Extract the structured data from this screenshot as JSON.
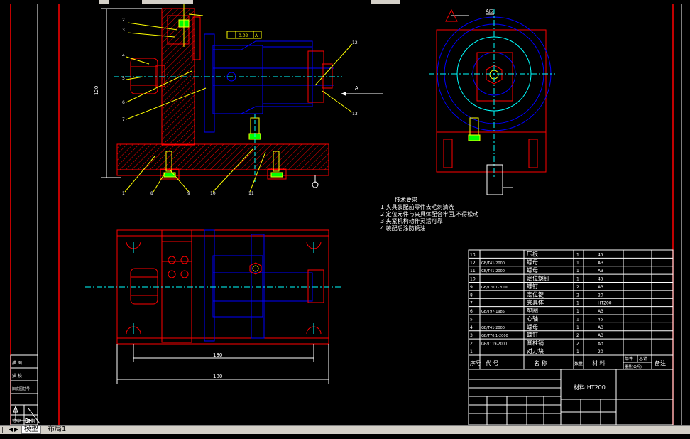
{
  "drawing": {
    "dim_side_height": "120",
    "dim_plan_inner": "130",
    "dim_plan_outer": "180",
    "datum_label": "A",
    "tolerance_value": "0.02",
    "tolerance_datum": "A",
    "top_view_label": "A向",
    "arrow_label": "A",
    "leader_numbers": [
      "1",
      "2",
      "3",
      "4",
      "5",
      "6",
      "7",
      "8",
      "9",
      "10",
      "11",
      "12",
      "13"
    ]
  },
  "technical_requirements": {
    "title": "技术要求",
    "items": [
      "1.夹具装配前零件去毛刺清洗",
      "2.定位元件与夹具体配合牢固,不得松动",
      "3.夹紧机构动作灵活可靠",
      "4.装配后涂防锈油"
    ]
  },
  "parts_list": {
    "rows": [
      {
        "no": "13",
        "code": "",
        "name": "压板",
        "qty": "1",
        "material": "45"
      },
      {
        "no": "12",
        "code": "GB/T41-2000",
        "name": "螺母",
        "qty": "1",
        "material": "A3"
      },
      {
        "no": "11",
        "code": "GB/T41-2000",
        "name": "螺母",
        "qty": "1",
        "material": "A3"
      },
      {
        "no": "10",
        "code": "",
        "name": "定位螺钉",
        "qty": "1",
        "material": "45"
      },
      {
        "no": "9",
        "code": "GB/T70.1-2000",
        "name": "螺钉",
        "qty": "2",
        "material": "A3"
      },
      {
        "no": "8",
        "code": "",
        "name": "定位键",
        "qty": "2",
        "material": "20"
      },
      {
        "no": "7",
        "code": "",
        "name": "夹具体",
        "qty": "1",
        "material": "HT200"
      },
      {
        "no": "6",
        "code": "GB/T97-1985",
        "name": "垫圈",
        "qty": "1",
        "material": "A3"
      },
      {
        "no": "5",
        "code": "",
        "name": "心轴",
        "qty": "1",
        "material": "45"
      },
      {
        "no": "4",
        "code": "GB/T41-2000",
        "name": "螺母",
        "qty": "1",
        "material": "A3"
      },
      {
        "no": "3",
        "code": "GB/T70.1-2000",
        "name": "螺钉",
        "qty": "2",
        "material": "A3"
      },
      {
        "no": "2",
        "code": "GB/T119-2000",
        "name": "圆柱销",
        "qty": "2",
        "material": "A3"
      },
      {
        "no": "1",
        "code": "",
        "name": "对刀块",
        "qty": "1",
        "material": "20"
      }
    ],
    "header": {
      "no": "序号",
      "code": "代 号",
      "name": "名 称",
      "qty": "数量",
      "material": "材 料",
      "weight1": "单件",
      "weight2": "总计",
      "weight_caption": "重量(公斤)",
      "note": "备注"
    }
  },
  "title_block": {
    "material_label": "材料:HT200"
  },
  "left_strip": {
    "labels": [
      "描 图",
      "描 校",
      "旧底图总号"
    ],
    "sign_label": "签字",
    "date_label": "日期"
  },
  "tabs": [
    {
      "label": "模型",
      "active": true
    },
    {
      "label": "布局1",
      "active": false
    }
  ],
  "colors": {
    "red": "#ff0000",
    "blue": "#0000ff",
    "cyan": "#00ffff",
    "yellow": "#ffff00",
    "white": "#ffffff",
    "green": "#00ff00",
    "magenta": "#ff00ff"
  }
}
